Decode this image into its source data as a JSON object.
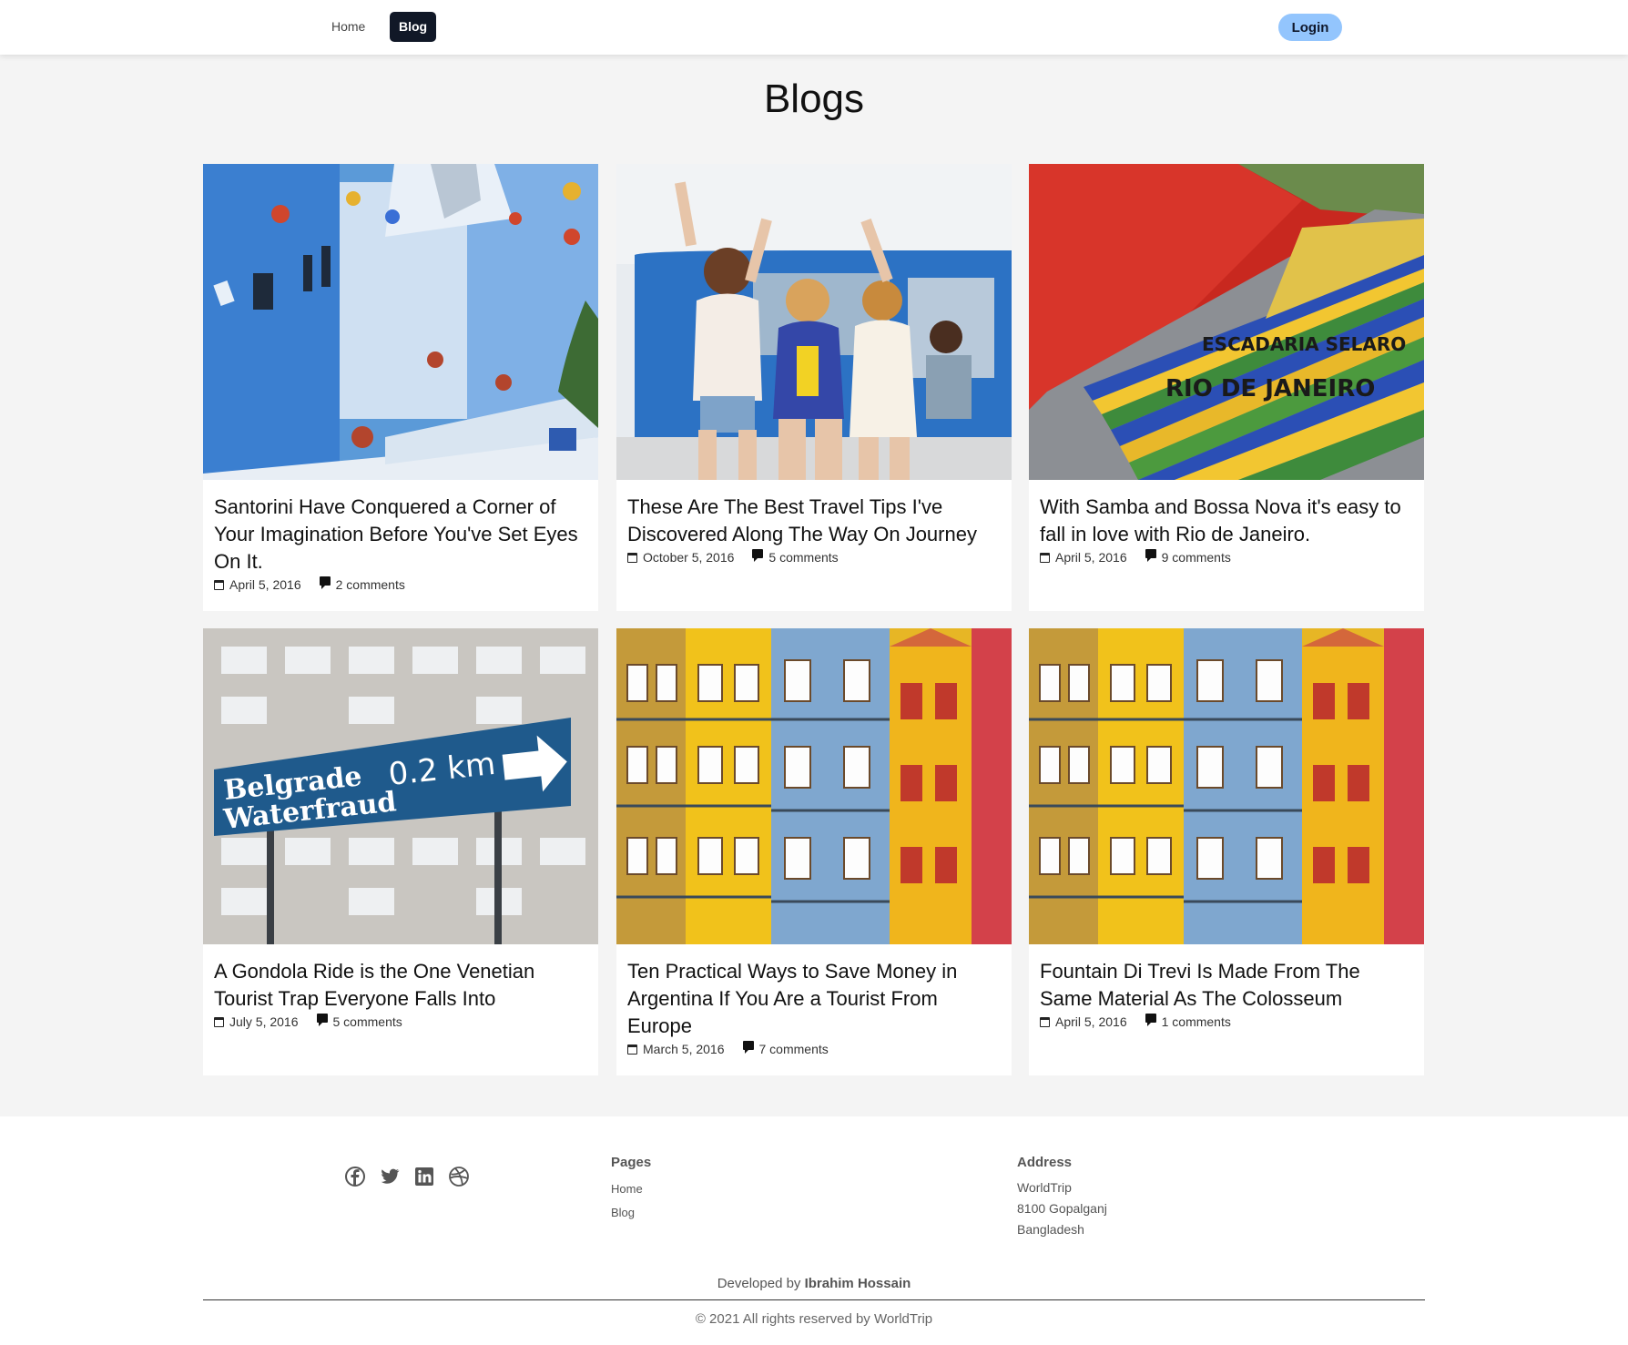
{
  "nav": {
    "home_label": "Home",
    "blog_label": "Blog",
    "login_label": "Login",
    "active_tab": "Blog"
  },
  "page_title": "Blogs",
  "posts": [
    {
      "title": "Santorini Have Conquered a Corner of Your Imagination Before You've Set Eyes On It.",
      "date": "April 5, 2016",
      "comments": "2 comments",
      "image": "blue-town-alley"
    },
    {
      "title": "These Are The Best Travel Tips I've Discovered Along The Way On Journey",
      "date": "October 5, 2016",
      "comments": "5 comments",
      "image": "friends-by-van"
    },
    {
      "title": "With Samba and Bossa Nova it's easy to fall in love with Rio de Janeiro.",
      "date": "April 5, 2016",
      "comments": "9 comments",
      "image": "mosaic-staircase"
    },
    {
      "title": "A Gondola Ride is the One Venetian Tourist Trap Everyone Falls Into",
      "date": "July 5, 2016",
      "comments": "5 comments",
      "image": "belgrade-sign"
    },
    {
      "title": "Ten Practical Ways to Save Money in Argentina If You Are a Tourist From Europe",
      "date": "March 5, 2016",
      "comments": "7 comments",
      "image": "colorful-facades"
    },
    {
      "title": "Fountain Di Trevi Is Made From The Same Material As The Colosseum",
      "date": "April 5, 2016",
      "comments": "1 comments",
      "image": "colorful-facades"
    }
  ],
  "image_text": {
    "sign_line1": "Belgrade",
    "sign_line2": "Waterfraud",
    "sign_distance": "0.2 km",
    "stairs_text1": "ESCADARIA SELARO",
    "stairs_text2": "RIO DE JANEIRO"
  },
  "footer": {
    "social_icons": [
      "facebook-icon",
      "twitter-icon",
      "linkedin-icon",
      "dribbble-icon"
    ],
    "pages_heading": "Pages",
    "pages_links": [
      "Home",
      "Blog"
    ],
    "address_heading": "Address",
    "address_lines": [
      "WorldTrip",
      "8100 Gopalganj",
      "Bangladesh"
    ],
    "developed_by_prefix": "Developed by",
    "developer_name": "Ibrahim Hossain",
    "copyright": "© 2021 All rights reserved by WorldTrip"
  },
  "colors": {
    "nav_active_bg": "#111827",
    "login_bg": "#93c5fd",
    "page_bg": "#f4f4f4"
  }
}
